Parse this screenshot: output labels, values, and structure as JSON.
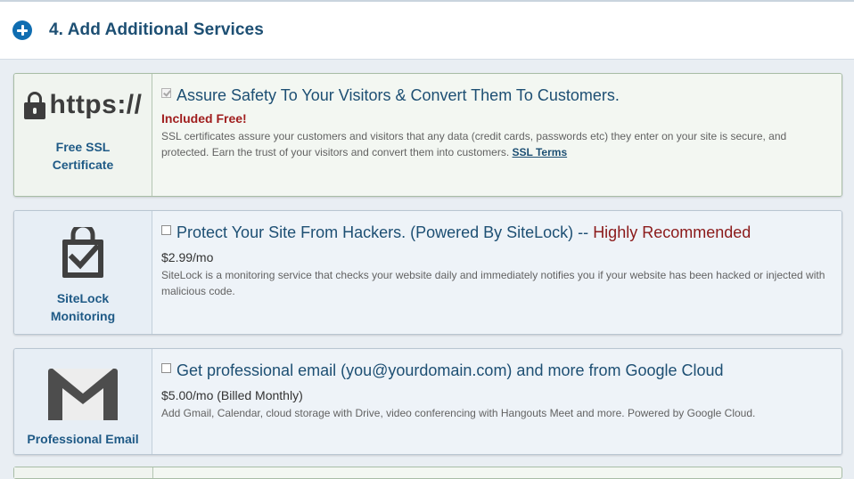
{
  "header": {
    "title": "4. Add Additional Services"
  },
  "services": [
    {
      "left_art": "https://",
      "left_caption_1": "Free SSL",
      "left_caption_2": "Certificate",
      "checked": true,
      "title": "Assure Safety To Your Visitors & Convert Them To Customers.",
      "badge": "Included Free!",
      "desc": "SSL certificates assure your customers and visitors that any data (credit cards, passwords etc) they enter on your site is secure, and protected. Earn the trust of your visitors and convert them into customers.",
      "link": "SSL Terms"
    },
    {
      "icon": "sitelock-shield-check-icon",
      "left_caption_1": "SiteLock",
      "left_caption_2": "Monitoring",
      "checked": false,
      "title": "Protect Your Site From Hackers. (Powered By SiteLock) --",
      "title_highlight": "Highly Recommended",
      "price": "$2.99/mo",
      "desc": "SiteLock is a monitoring service that checks your website daily and immediately notifies you if your website has been hacked or injected with malicious code."
    },
    {
      "icon": "email-envelope-icon",
      "left_caption_1": "Professional Email",
      "checked": false,
      "title": "Get professional email (you@yourdomain.com) and more from Google Cloud",
      "price": "$5.00/mo (Billed Monthly)",
      "desc": "Add Gmail, Calendar, cloud storage with Drive, video conferencing with Hangouts Meet and more. Powered by Google Cloud."
    }
  ],
  "colors": {
    "accent": "#0f6db1",
    "heading": "#1d4f73",
    "highlight": "#8b1a1a",
    "ssl_card_bg": "#f3f7f2",
    "blue_card_bg": "#eef3f8"
  }
}
